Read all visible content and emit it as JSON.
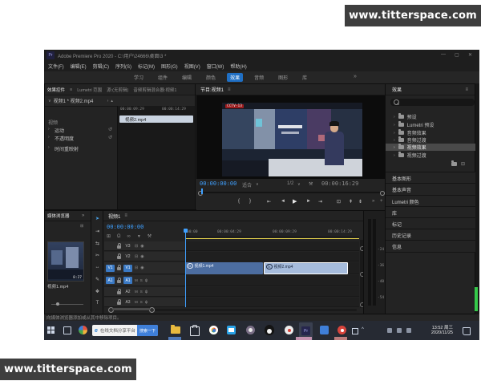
{
  "watermarks": {
    "top_right": "www.titterspace.com",
    "bottom_left": "www.titterspace.com"
  },
  "titlebar": {
    "app_abbr": "Pr",
    "title": "Adobe Premiere Pro 2020 - C:\\用户\\24666\\桌面\\3 *",
    "minimize": "—",
    "maximize": "▢",
    "close": "✕"
  },
  "menubar": {
    "items": [
      "文件(F)",
      "编辑(E)",
      "剪辑(C)",
      "序列(S)",
      "标记(M)",
      "图形(G)",
      "视图(V)",
      "窗口(W)",
      "帮助(H)"
    ]
  },
  "workspaces": {
    "tabs": [
      "学习",
      "组件",
      "编辑",
      "颜色",
      "效果",
      "音频",
      "图形",
      "库"
    ],
    "active": "效果",
    "overflow": "»"
  },
  "effect_controls": {
    "tab_active": "效果控件",
    "tab_lumetri": "Lumetri 范围",
    "tab_source": "源:(无剪辑)",
    "tab_mixer": "音频剪辑混合器:视频1",
    "clip_selector": "视频1 * 视频2.mp4",
    "ruler_start": "00:00:09:29",
    "ruler_end": "00:00:14:29",
    "clip_bar": "视频2.mp4",
    "section": "视频",
    "effects": [
      "运动",
      "不透明度",
      "时间重映射"
    ]
  },
  "program": {
    "tab": "节目:视频1",
    "timecode": "00:00:00:00",
    "zoom_level": "适合",
    "playback_resolution": "1/2",
    "duration": "00:00:16:29",
    "channel": "CCTV-13"
  },
  "effects_panel": {
    "tab": "效果",
    "bins": [
      "预设",
      "Lumetri 预设",
      "音频效果",
      "音频过渡",
      "视频效果",
      "视频过渡"
    ],
    "selected_bin": "视频效果",
    "stack_tabs": [
      "基本图形",
      "基本声音",
      "Lumetri 颜色",
      "库",
      "标记",
      "历史记录",
      "信息"
    ]
  },
  "project_panel": {
    "tab": "媒体浏览器",
    "clip_name": "视频1.mp4",
    "clip_duration": "8:27"
  },
  "timeline": {
    "tab": "视频1",
    "timecode": "00:00:00:00",
    "ruler": [
      "00:00",
      "00:00:04:29",
      "00:00:09:29",
      "00:00:14:29"
    ],
    "video_tracks": [
      "V3",
      "V2",
      "V1"
    ],
    "audio_tracks": [
      "A1",
      "A2",
      "A3"
    ],
    "source_video_badge": "V1",
    "source_audio_badge": "A1",
    "clip1": "视频1.mp4",
    "clip2": "视频2.mp4",
    "mute": "M",
    "solo": "S",
    "fx": "fx"
  },
  "audio_meter": {
    "ticks": [
      "-24",
      "-36",
      "-48",
      "-54"
    ]
  },
  "status_bar": {
    "text": "向媒体浏览器添加或从其中移除项目。"
  },
  "taskbar": {
    "search_text": "在线文档分享平台",
    "search_button": "搜索一下",
    "time": "13:52 周三",
    "date": "2020/11/25"
  },
  "icons": {
    "menu": "≡",
    "overflow": "»",
    "chev_down": "∨",
    "chev_right": "›",
    "collapse": "▴",
    "reset": "↺",
    "play": "▶",
    "step_back": "◄",
    "step_fwd": "►",
    "go_in": "⇤",
    "go_out": "⇥",
    "mark_in": "{",
    "mark_out": "}",
    "export_frame": "⊡",
    "lift": "⇞",
    "extract": "⇟",
    "add": "+",
    "wrench": "⚒",
    "snap": "Ω",
    "link": "∞",
    "marker": "▼",
    "nest": "⊞",
    "eye": "◉",
    "sync": "⊟",
    "mic": "ψ",
    "caret": "^",
    "tools": [
      "➤",
      "⇥",
      "⇆",
      "✂",
      "↔",
      "✎",
      "❖",
      "T"
    ]
  }
}
